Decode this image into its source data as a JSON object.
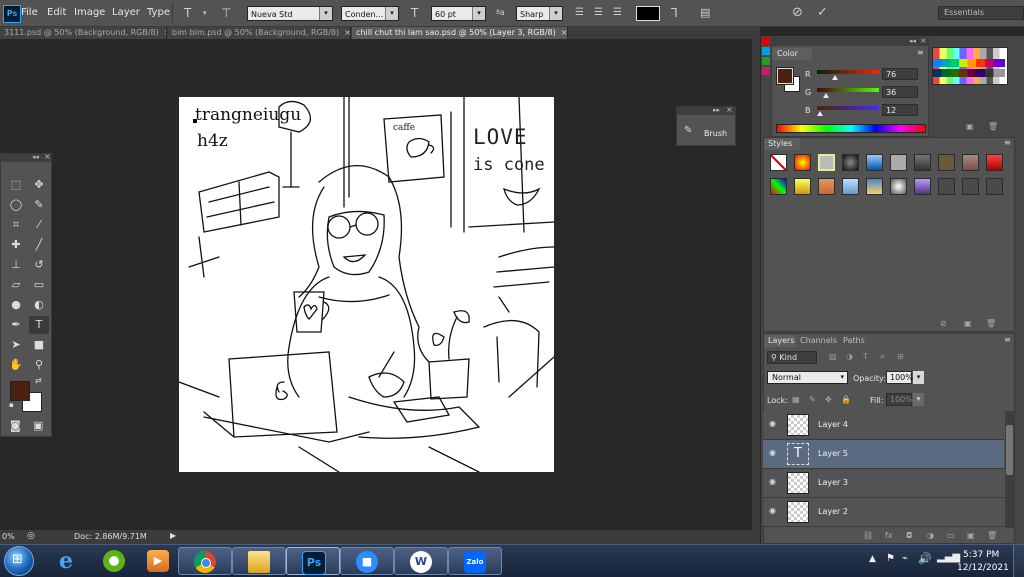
{
  "menu": {
    "items": [
      "File",
      "Edit",
      "Image",
      "Layer",
      "Type"
    ]
  },
  "options": {
    "font_family": "Nueva Std",
    "font_style": "Conden...",
    "font_size": "60 pt",
    "aa_label": "ªa",
    "antialias": "Sharp",
    "workspace": "Essentials",
    "text_color": "#000000"
  },
  "tabs": [
    {
      "label": "3111.psd @ 50% (Background, RGB/8)",
      "close": "×"
    },
    {
      "label": "bim bim.psd @ 50% (Background, RGB/8)",
      "close": "×"
    },
    {
      "label": "chill chut thi lam sao.psd @ 50% (Layer 3, RGB/8)",
      "close": "×"
    }
  ],
  "canvas": {
    "text_line1": "trangneiugu",
    "text_line2": "h4z",
    "sign_cafe": "caffe",
    "sign_love_1": "LOVE",
    "sign_love_2": "is cone"
  },
  "colors": {
    "foreground": "#4a2010",
    "background": "#ffffff"
  },
  "brush_panel": {
    "label": "Brush"
  },
  "color_panel": {
    "tab": "Color",
    "r_label": "R",
    "r_value": "76",
    "r_fraction": 0.298,
    "g_label": "G",
    "g_value": "36",
    "g_fraction": 0.141,
    "b_label": "B",
    "b_value": "12",
    "b_fraction": 0.047
  },
  "styles_panel": {
    "tab": "Styles"
  },
  "layers_panel": {
    "tabs": [
      "Layers",
      "Channels",
      "Paths"
    ],
    "filter": "Kind",
    "blend_mode": "Normal",
    "opacity_label": "Opacity:",
    "opacity_value": "100%",
    "lock_label": "Lock:",
    "fill_label": "Fill:",
    "fill_value": "100%",
    "layers": [
      {
        "name": "Layer 4",
        "type": "pixel",
        "selected": false
      },
      {
        "name": "Layer 5",
        "type": "text",
        "selected": true
      },
      {
        "name": "Layer 3",
        "type": "pixel",
        "selected": false
      },
      {
        "name": "Layer 2",
        "type": "pixel",
        "selected": false
      }
    ]
  },
  "status": {
    "zoom": "0%",
    "doc": "Doc: 2.86M/9.71M"
  },
  "taskbar": {
    "apps": [
      "Internet Explorer",
      "Coc Coc",
      "Media Player",
      "Chrome",
      "File Explorer",
      "Photoshop",
      "Zoom",
      "W",
      "Zalo"
    ],
    "ps_label": "Ps",
    "w_label": "W",
    "zalo_label": "Zalo",
    "time": "5:37 PM",
    "date": "12/12/2021"
  }
}
